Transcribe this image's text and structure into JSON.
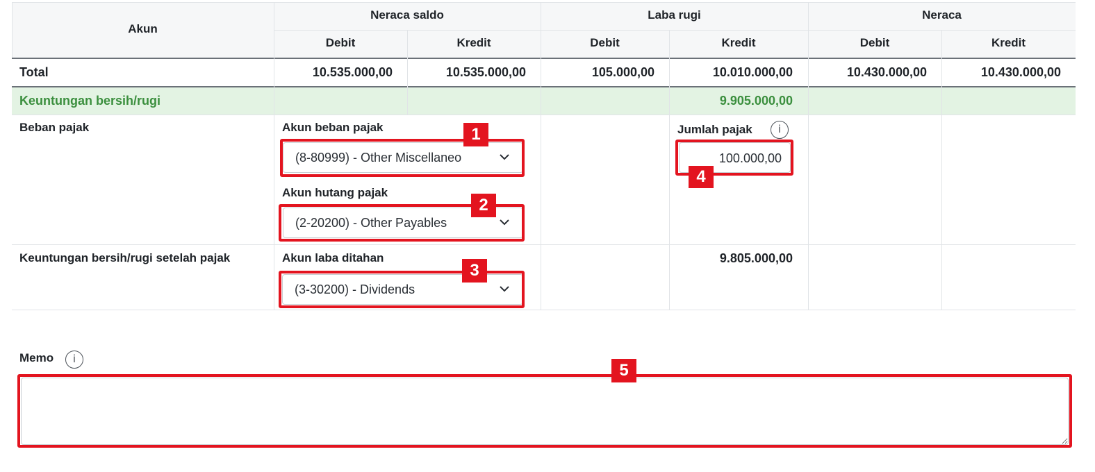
{
  "table": {
    "col_akun": "Akun",
    "group_neraca_saldo": "Neraca saldo",
    "group_laba_rugi": "Laba rugi",
    "group_neraca": "Neraca",
    "debit": "Debit",
    "kredit": "Kredit",
    "total_row": {
      "label": "Total",
      "ns_debit": "10.535.000,00",
      "ns_kredit": "10.535.000,00",
      "lr_debit": "105.000,00",
      "lr_kredit": "10.010.000,00",
      "n_debit": "10.430.000,00",
      "n_kredit": "10.430.000,00"
    },
    "profit_row": {
      "label": "Keuntungan bersih/rugi",
      "lr_kredit": "9.905.000,00"
    },
    "tax_row": {
      "label": "Beban pajak",
      "expense_account_label": "Akun beban pajak",
      "expense_account_value": "(8-80999) - Other Miscellaneo",
      "payable_account_label": "Akun hutang pajak",
      "payable_account_value": "(2-20200) - Other Payables",
      "tax_amount_label": "Jumlah pajak",
      "tax_amount_value": "100.000,00"
    },
    "after_tax_row": {
      "label": "Keuntungan bersih/rugi setelah pajak",
      "retained_account_label": "Akun laba ditahan",
      "retained_account_value": "(3-30200) - Dividends",
      "lr_kredit": "9.805.000,00"
    }
  },
  "memo": {
    "label": "Memo",
    "value": ""
  },
  "annotations": [
    "1",
    "2",
    "3",
    "4",
    "5"
  ],
  "colors": {
    "green_text": "#3b8f3e",
    "green_row": "#e3f3e3",
    "header_bg": "#f6f7f8",
    "annotation_red": "#e3141f"
  }
}
